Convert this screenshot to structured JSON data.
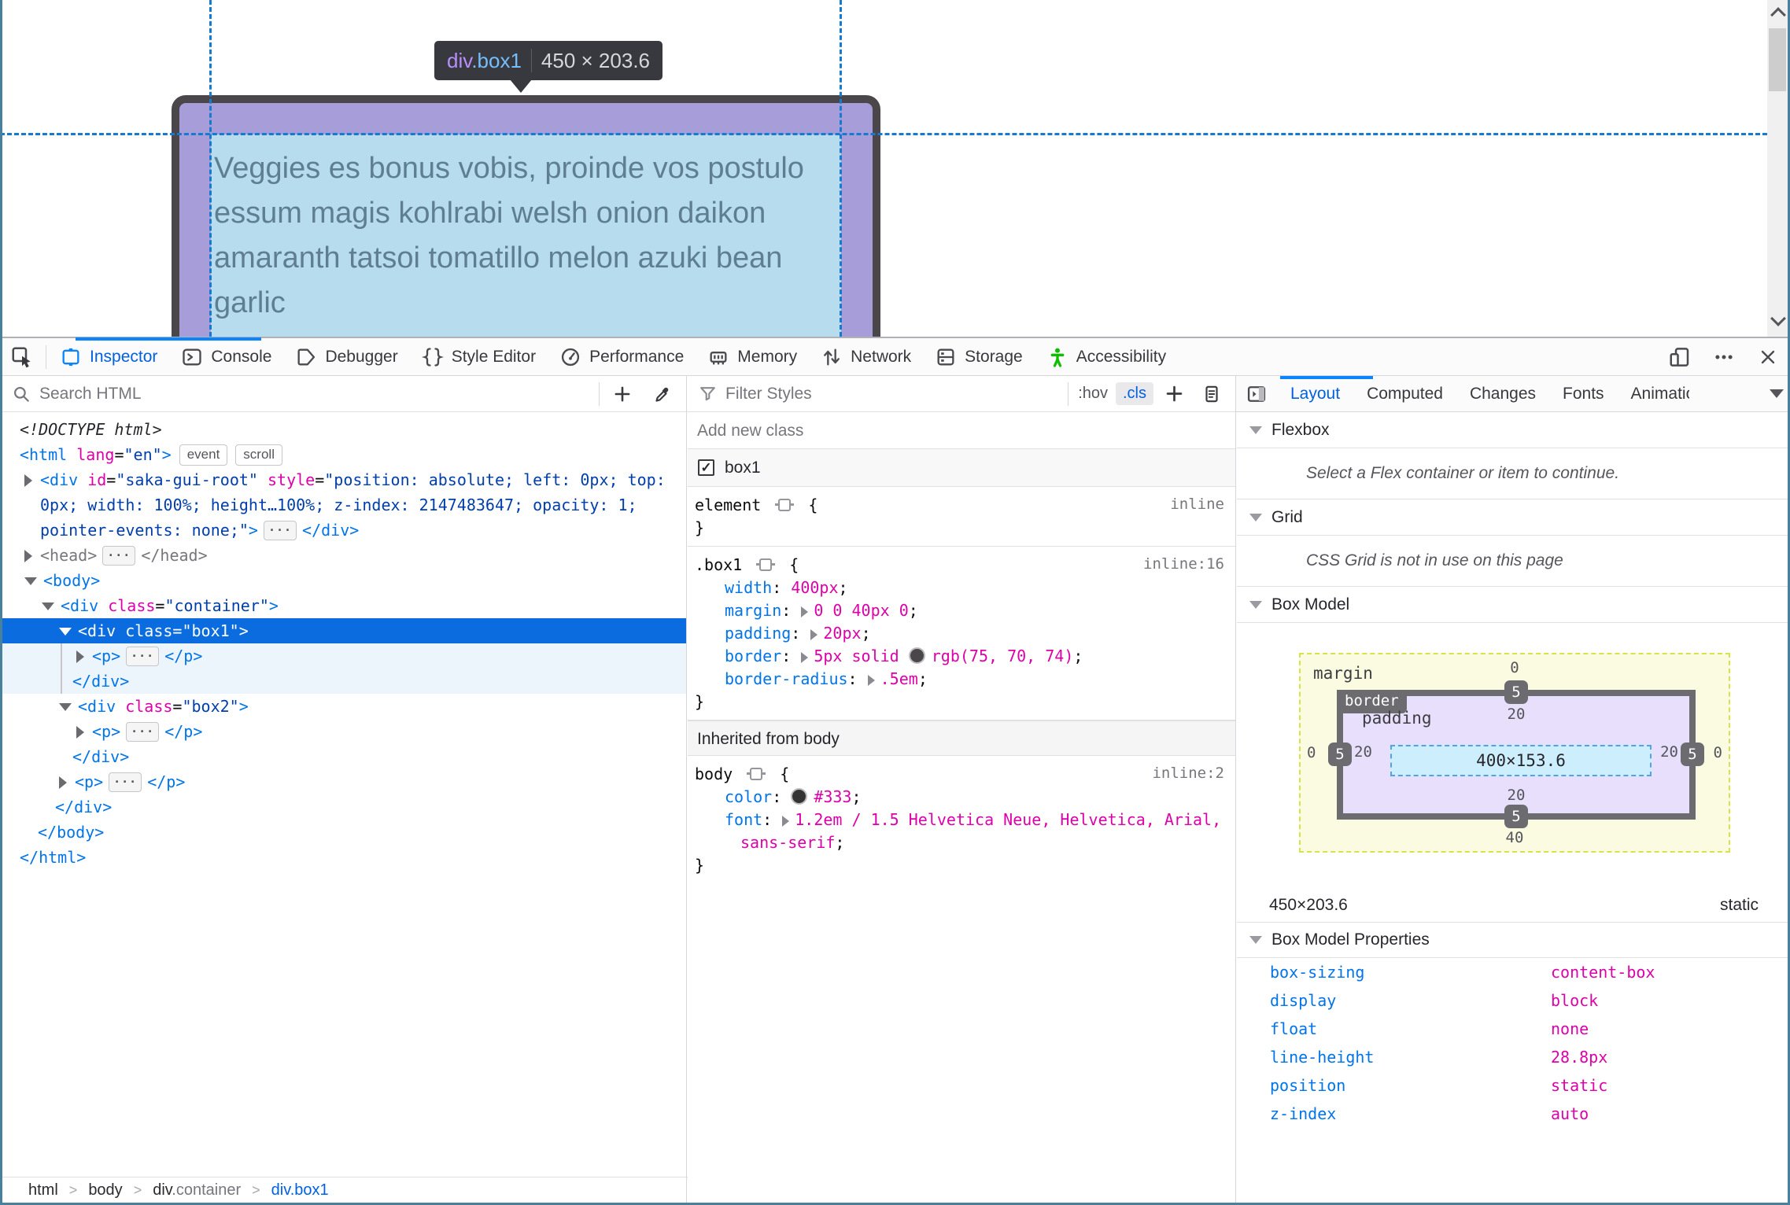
{
  "viewport": {
    "tooltip": {
      "tag": "div",
      "cls": ".box1",
      "dims": "450 × 203.6"
    },
    "text_lines": {
      "0": "Veggies es bonus vobis, proinde vos postulo",
      "1": "essum magis kohlrabi welsh onion daikon",
      "2": "amaranth tatsoi tomatillo melon azuki bean",
      "3": "garlic"
    },
    "colors": {
      "box_border": "#4b464a",
      "padding_overlay": "#a79dd8",
      "content_overlay": "#b6dcee",
      "guide": "#1779cf"
    }
  },
  "toolbox": {
    "tabs": {
      "0": {
        "label": "Inspector"
      },
      "1": {
        "label": "Console"
      },
      "2": {
        "label": "Debugger"
      },
      "3": {
        "label": "Style Editor"
      },
      "4": {
        "label": "Performance"
      },
      "5": {
        "label": "Memory"
      },
      "6": {
        "label": "Network"
      },
      "7": {
        "label": "Storage"
      },
      "8": {
        "label": "Accessibility"
      }
    },
    "accent_color": "#0a84ff"
  },
  "markup": {
    "search_placeholder": "Search HTML",
    "rows": {
      "0": [
        {
          "c": "doctype",
          "s": "<!DOCTYPE html>"
        }
      ],
      "1": [
        {
          "c": "tag",
          "s": "<html"
        },
        {
          "c": "attr",
          "s": " lang"
        },
        {
          "c": "p",
          "s": "="
        },
        {
          "c": "val",
          "s": "\"en\""
        },
        {
          "c": "tag",
          "s": ">"
        },
        {
          "c": "badge",
          "s": "event"
        },
        {
          "c": "badge",
          "s": "scroll"
        }
      ],
      "2": [
        {
          "c": "twr",
          "s": ""
        },
        {
          "c": "tag",
          "s": "<div"
        },
        {
          "c": "attr",
          "s": " id"
        },
        {
          "c": "p",
          "s": "="
        },
        {
          "c": "val",
          "s": "\"saka-gui-root\""
        },
        {
          "c": "attr",
          "s": " style"
        },
        {
          "c": "p",
          "s": "="
        },
        {
          "c": "val",
          "s": "\"position: absolute; left: 0px; top:"
        }
      ],
      "3": [
        {
          "c": "val",
          "s": "0px; width: 100%; height…100%; z-index: 2147483647; opacity: 1;"
        }
      ],
      "4": [
        {
          "c": "val",
          "s": "pointer-events: none;\""
        },
        {
          "c": "tag",
          "s": ">"
        },
        {
          "c": "chip",
          "s": "···"
        },
        {
          "c": "tag",
          "s": "</div>"
        }
      ],
      "5": [
        {
          "c": "twr",
          "s": ""
        },
        {
          "c": "dim",
          "s": "<head>"
        },
        {
          "c": "chip",
          "s": "···"
        },
        {
          "c": "dim",
          "s": "</head>"
        }
      ],
      "6": [
        {
          "c": "twd",
          "s": ""
        },
        {
          "c": "tag",
          "s": "<body>"
        }
      ],
      "7": [
        {
          "c": "twd",
          "s": ""
        },
        {
          "c": "tag",
          "s": "<div"
        },
        {
          "c": "attr",
          "s": " class"
        },
        {
          "c": "p",
          "s": "="
        },
        {
          "c": "val",
          "s": "\"container\""
        },
        {
          "c": "tag",
          "s": ">"
        }
      ],
      "8": [
        {
          "c": "twd",
          "s": ""
        },
        {
          "c": "tag",
          "s": "<div"
        },
        {
          "c": "attr",
          "s": " class"
        },
        {
          "c": "p",
          "s": "="
        },
        {
          "c": "val",
          "s": "\"box1\""
        },
        {
          "c": "tag",
          "s": ">"
        }
      ],
      "9": [
        {
          "c": "twr",
          "s": ""
        },
        {
          "c": "tag",
          "s": "<p>"
        },
        {
          "c": "chip",
          "s": "···"
        },
        {
          "c": "tag",
          "s": "</p>"
        }
      ],
      "10": [
        {
          "c": "tag",
          "s": "</div>"
        }
      ],
      "11": [
        {
          "c": "twd",
          "s": ""
        },
        {
          "c": "tag",
          "s": "<div"
        },
        {
          "c": "attr",
          "s": " class"
        },
        {
          "c": "p",
          "s": "="
        },
        {
          "c": "val",
          "s": "\"box2\""
        },
        {
          "c": "tag",
          "s": ">"
        }
      ],
      "12": [
        {
          "c": "twr",
          "s": ""
        },
        {
          "c": "tag",
          "s": "<p>"
        },
        {
          "c": "chip",
          "s": "···"
        },
        {
          "c": "tag",
          "s": "</p>"
        }
      ],
      "13": [
        {
          "c": "tag",
          "s": "</div>"
        }
      ],
      "14": [
        {
          "c": "twr",
          "s": ""
        },
        {
          "c": "tag",
          "s": "<p>"
        },
        {
          "c": "chip",
          "s": "···"
        },
        {
          "c": "tag",
          "s": "</p>"
        }
      ],
      "15": [
        {
          "c": "tag",
          "s": "</div>"
        }
      ],
      "16": [
        {
          "c": "tag",
          "s": "</body>"
        }
      ],
      "17": [
        {
          "c": "tag",
          "s": "</html>"
        }
      ]
    },
    "breadcrumbs": {
      "sep": ">",
      "0": {
        "label": "html"
      },
      "1": {
        "label": "body"
      },
      "2": {
        "label": "div",
        "suffix": ".container"
      },
      "3": {
        "label": "div.box1"
      }
    }
  },
  "rules": {
    "filter_placeholder": "Filter Styles",
    "hov_label": ":hov",
    "cls_label": ".cls",
    "add_class_placeholder": "Add new class",
    "class_name": "box1",
    "checkbox_glyph": "✓",
    "element_rule": {
      "selector": [
        {
          "c": "p",
          "s": "element "
        },
        {
          "c": "tgt",
          "s": ""
        },
        {
          "c": "p",
          "s": " {"
        }
      ],
      "link": "inline",
      "close": "}"
    },
    "box1_rule": {
      "selector": [
        {
          "c": "p",
          "s": ".box1 "
        },
        {
          "c": "tgt",
          "s": ""
        },
        {
          "c": "p",
          "s": " {"
        }
      ],
      "link": "inline:16",
      "lines": {
        "0": [
          {
            "c": "name",
            "s": "width"
          },
          {
            "c": "p",
            "s": ": "
          },
          {
            "c": "pv",
            "s": "400px"
          },
          {
            "c": "p",
            "s": ";"
          }
        ],
        "1": [
          {
            "c": "name",
            "s": "margin"
          },
          {
            "c": "p",
            "s": ": "
          },
          {
            "c": "exp",
            "s": ""
          },
          {
            "c": "pv",
            "s": "0 0 40px 0"
          },
          {
            "c": "p",
            "s": ";"
          }
        ],
        "2": [
          {
            "c": "name",
            "s": "padding"
          },
          {
            "c": "p",
            "s": ": "
          },
          {
            "c": "exp",
            "s": ""
          },
          {
            "c": "pv",
            "s": "20px"
          },
          {
            "c": "p",
            "s": ";"
          }
        ],
        "3": [
          {
            "c": "name",
            "s": "border"
          },
          {
            "c": "p",
            "s": ": "
          },
          {
            "c": "exp",
            "s": ""
          },
          {
            "c": "pv",
            "s": "5px solid "
          },
          {
            "c": "sw1",
            "s": ""
          },
          {
            "c": "pv",
            "s": "rgb(75, 70, 74)"
          },
          {
            "c": "p",
            "s": ";"
          }
        ],
        "4": [
          {
            "c": "name",
            "s": "border-radius"
          },
          {
            "c": "p",
            "s": ": "
          },
          {
            "c": "exp",
            "s": ""
          },
          {
            "c": "pv",
            "s": ".5em"
          },
          {
            "c": "p",
            "s": ";"
          }
        ]
      },
      "close": "}"
    },
    "inherited_header": "Inherited from body",
    "body_rule": {
      "selector": [
        {
          "c": "p",
          "s": "body "
        },
        {
          "c": "tgt",
          "s": ""
        },
        {
          "c": "p",
          "s": " {"
        }
      ],
      "link": "inline:2",
      "lines": {
        "0": [
          {
            "c": "name",
            "s": "color"
          },
          {
            "c": "p",
            "s": ": "
          },
          {
            "c": "sw2",
            "s": ""
          },
          {
            "c": "pv",
            "s": "#333"
          },
          {
            "c": "p",
            "s": ";"
          }
        ],
        "1": [
          {
            "c": "name",
            "s": "font"
          },
          {
            "c": "p",
            "s": ": "
          },
          {
            "c": "exp",
            "s": ""
          },
          {
            "c": "pv",
            "s": "1.2em / 1.5 Helvetica Neue, Helvetica, Arial,"
          }
        ],
        "2": [
          {
            "c": "pv",
            "s": "sans-serif"
          },
          {
            "c": "p",
            "s": ";"
          }
        ]
      },
      "close": "}"
    }
  },
  "sidebar": {
    "tabs": {
      "0": {
        "label": "Layout"
      },
      "1": {
        "label": "Computed"
      },
      "2": {
        "label": "Changes"
      },
      "3": {
        "label": "Fonts"
      },
      "4": {
        "label": "Animations"
      }
    },
    "flexbox": {
      "title": "Flexbox",
      "message": "Select a Flex container or item to continue."
    },
    "grid": {
      "title": "Grid",
      "message": "CSS Grid is not in use on this page"
    },
    "box_model": {
      "title": "Box Model",
      "margin_label": "margin",
      "border_label": "border",
      "padding_label": "padding",
      "margin": {
        "top": "0",
        "right": "0",
        "bottom": "40",
        "left": "0"
      },
      "border": {
        "top": "5",
        "right": "5",
        "bottom": "5",
        "left": "5"
      },
      "padding": {
        "top": "20",
        "right": "20",
        "bottom": "20",
        "left": "20"
      },
      "content": "400×153.6",
      "dimensions": "450×203.6",
      "position": "static",
      "properties_title": "Box Model Properties",
      "properties": {
        "0": {
          "name": "box-sizing",
          "value": "content-box"
        },
        "1": {
          "name": "display",
          "value": "block"
        },
        "2": {
          "name": "float",
          "value": "none"
        },
        "3": {
          "name": "line-height",
          "value": "28.8px"
        },
        "4": {
          "name": "position",
          "value": "static"
        },
        "5": {
          "name": "z-index",
          "value": "auto"
        }
      }
    }
  }
}
